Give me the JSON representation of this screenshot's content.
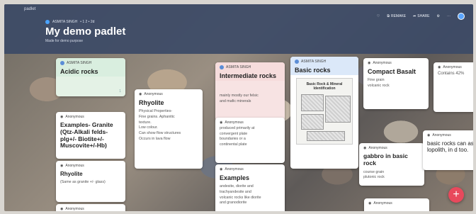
{
  "header": {
    "app_name": "padlet",
    "author": "ASMITA SINGH",
    "author_meta": "• 1 2  • 2d",
    "title": "My demo padlet",
    "subtitle": "Made for demo purpose",
    "toolbar": {
      "remake": "REMAKE",
      "share": "SHARE"
    }
  },
  "cards": {
    "acidic": {
      "author": "ASMITA SINGH",
      "title": "Acidic rocks",
      "count": "1"
    },
    "granite": {
      "author": "Anonymous",
      "title": "Examples- Granite (Qtz-Alkali felds-plg+/- Biotite+/- Muscovite+/-Hb)"
    },
    "rhyolite_small": {
      "author": "Anonymous",
      "title": "Rhyolite",
      "body": "(Same as granite +/- glass)"
    },
    "rhyolite": {
      "author": "Anonymous",
      "title": "Rhyolite",
      "body": [
        "Physical Properties-",
        "Fine grains. Aphanitic",
        "texture.",
        "Low colour.",
        "Can show flow structures",
        "Occurs in lava flow"
      ]
    },
    "intermediate": {
      "author": "ASMITA SINGH",
      "title": "Intermediate rocks",
      "body": [
        "mainly mostly our felsic",
        "and mafic minerals"
      ]
    },
    "intermediate_anon": {
      "author": "Anonymous",
      "body": [
        "produced primarily at",
        "convergent plate",
        "boundaries or a",
        "continental plate"
      ]
    },
    "examples": {
      "author": "Anonymous",
      "title": "Examples",
      "body": [
        "andesite, diorite and",
        "trachyandesite and",
        "volcanic rocks like diorite",
        "and granodiorite"
      ]
    },
    "basic": {
      "author": "ASMITA SINGH",
      "title": "Basic rocks",
      "sheet_title": "Basic Rock & Mineral",
      "sheet_sub": "Identification"
    },
    "basalt": {
      "author": "Anonymous",
      "title": "Compact Basalt",
      "body": [
        "Fine grain",
        "volcanic rock"
      ]
    },
    "gabbro": {
      "author": "Anonymous",
      "title": "gabbro in basic rock",
      "body": [
        "course grain",
        "plutonic rock"
      ]
    },
    "contains": {
      "author": "Anonymous",
      "body": "Contains 42%"
    },
    "lopolith": {
      "author": "Anonymous",
      "title": "basic rocks can as lopolith, in d too."
    },
    "bottom_anon": {
      "author": "Anonymous"
    },
    "bottom_left_anon": {
      "author": "Anonymous"
    }
  },
  "fab": {
    "label": "+"
  }
}
